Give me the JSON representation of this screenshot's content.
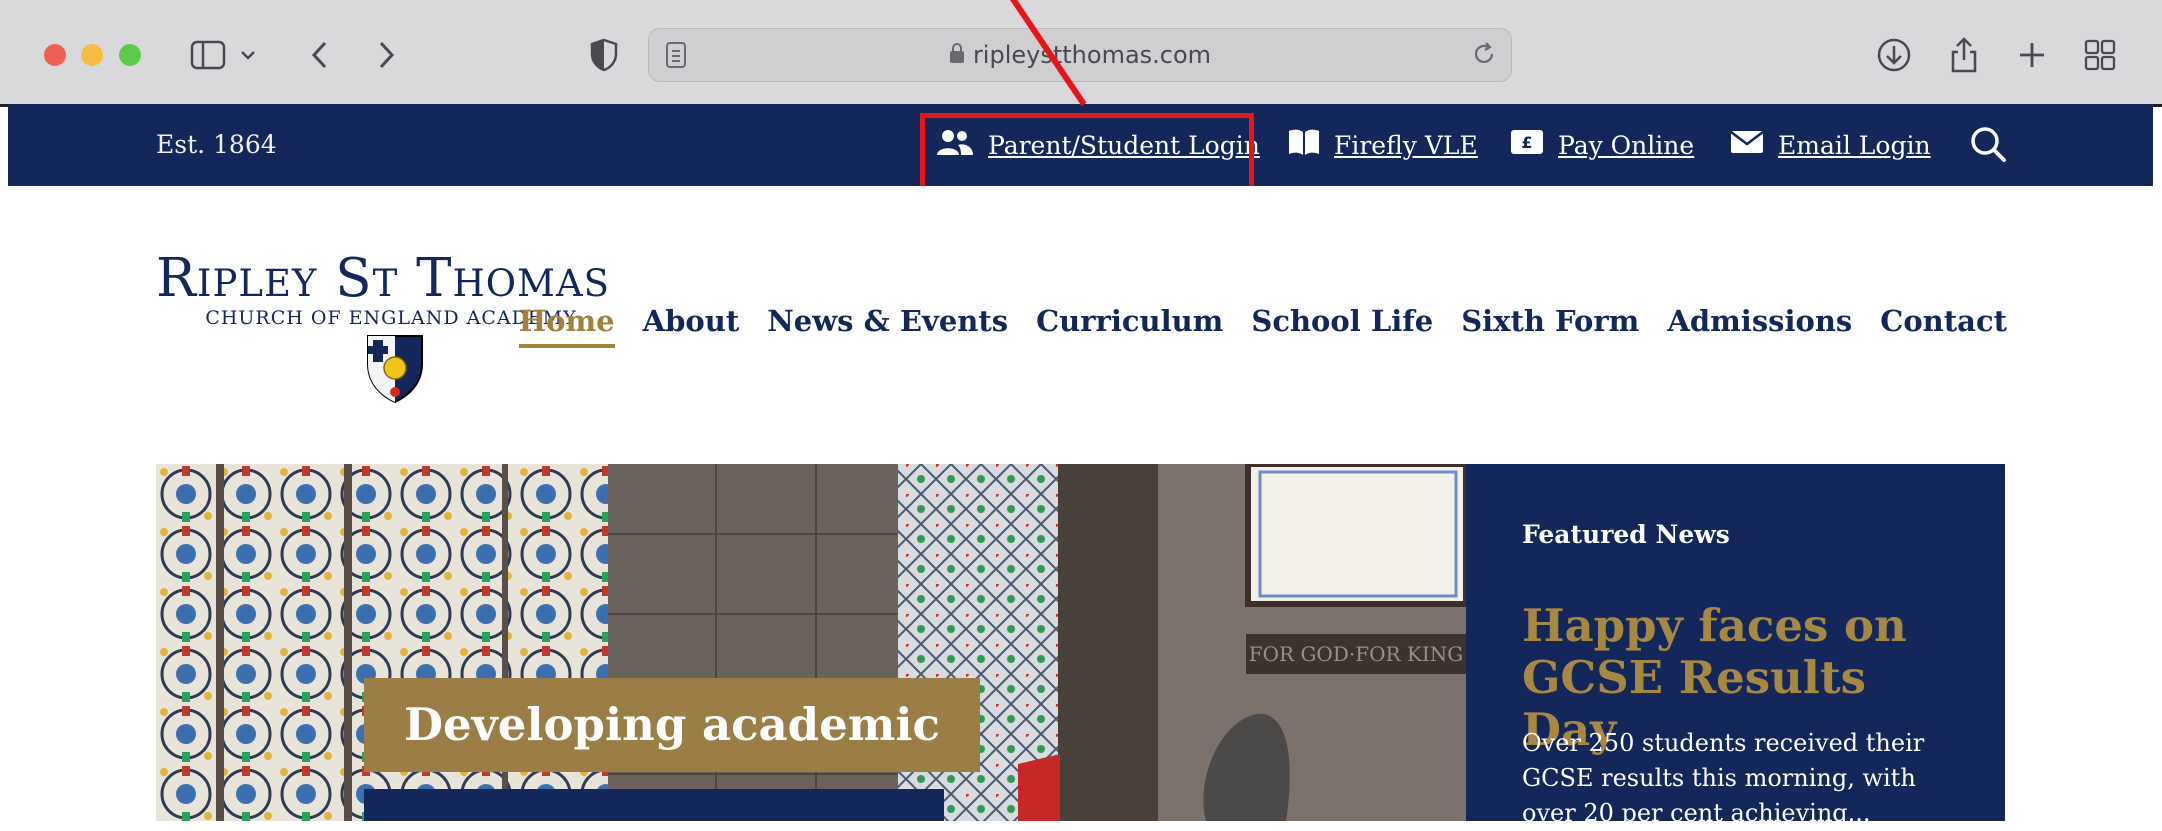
{
  "browser": {
    "url": "ripleystthomas.com"
  },
  "topbar": {
    "est": "Est. 1864",
    "links": [
      {
        "label": "Parent/Student Login",
        "icon": "users-icon"
      },
      {
        "label": "Firefly VLE",
        "icon": "book-icon"
      },
      {
        "label": "Pay Online",
        "icon": "pound-icon"
      },
      {
        "label": "Email Login",
        "icon": "envelope-icon"
      }
    ]
  },
  "logo": {
    "title": "Ripley St Thomas",
    "subtitle": "CHURCH OF ENGLAND ACADEMY"
  },
  "nav": {
    "items": [
      "Home",
      "About",
      "News & Events",
      "Curriculum",
      "School Life",
      "Sixth Form",
      "Admissions",
      "Contact"
    ],
    "active": "Home"
  },
  "hero": {
    "caption": "Developing academic"
  },
  "featured": {
    "kicker": "Featured News",
    "title": "Happy faces on GCSE Results Day",
    "body": "Over 250 students received their GCSE results this morning, with over 20 per cent achieving..."
  },
  "colors": {
    "navy": "#13275b",
    "gold": "#a0813e",
    "highlight": "#e8141b"
  }
}
